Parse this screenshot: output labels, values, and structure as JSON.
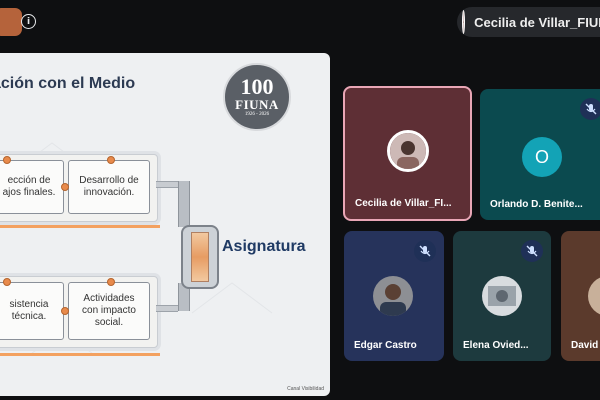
{
  "topbar": {
    "host_initial": "",
    "info_icon": "i",
    "presenter_name": "Cecilia de Villar_FIUNA"
  },
  "slide": {
    "title": "ación con el Medio",
    "logo_number": "100",
    "logo_text": "FIUNA",
    "logo_years": "1926 - 2026",
    "cards": {
      "tl": "ección de\najos finales.",
      "tr": "Desarrollo de\ninnovación.",
      "bl": "sistencia\ntécnica.",
      "br": "Actividades\ncon impacto\nsocial."
    },
    "center_label": "Asignatura",
    "footer": "Canal Visibilidad"
  },
  "tiles": [
    {
      "name": "Cecilia de Villar_FI...",
      "bg": "#5e2f35",
      "highlight": "#e9a6b6",
      "muted": false
    },
    {
      "name": "Orlando D. Benite...",
      "bg": "#0b4a4f",
      "avatar_letter": "O",
      "avatar_color": "#13a3b6",
      "muted": true
    },
    {
      "name": "Edgar Castro",
      "bg": "#26335b",
      "muted": true
    },
    {
      "name": "Elena Ovied...",
      "bg": "#1d3a3e",
      "muted": true
    },
    {
      "name": "David",
      "bg": "#5b3a2c",
      "muted": false
    }
  ],
  "colors": {
    "background": "#0e0f11",
    "mute_badge": "#1f3057",
    "active_speaker_border": "#e9a6b6"
  }
}
